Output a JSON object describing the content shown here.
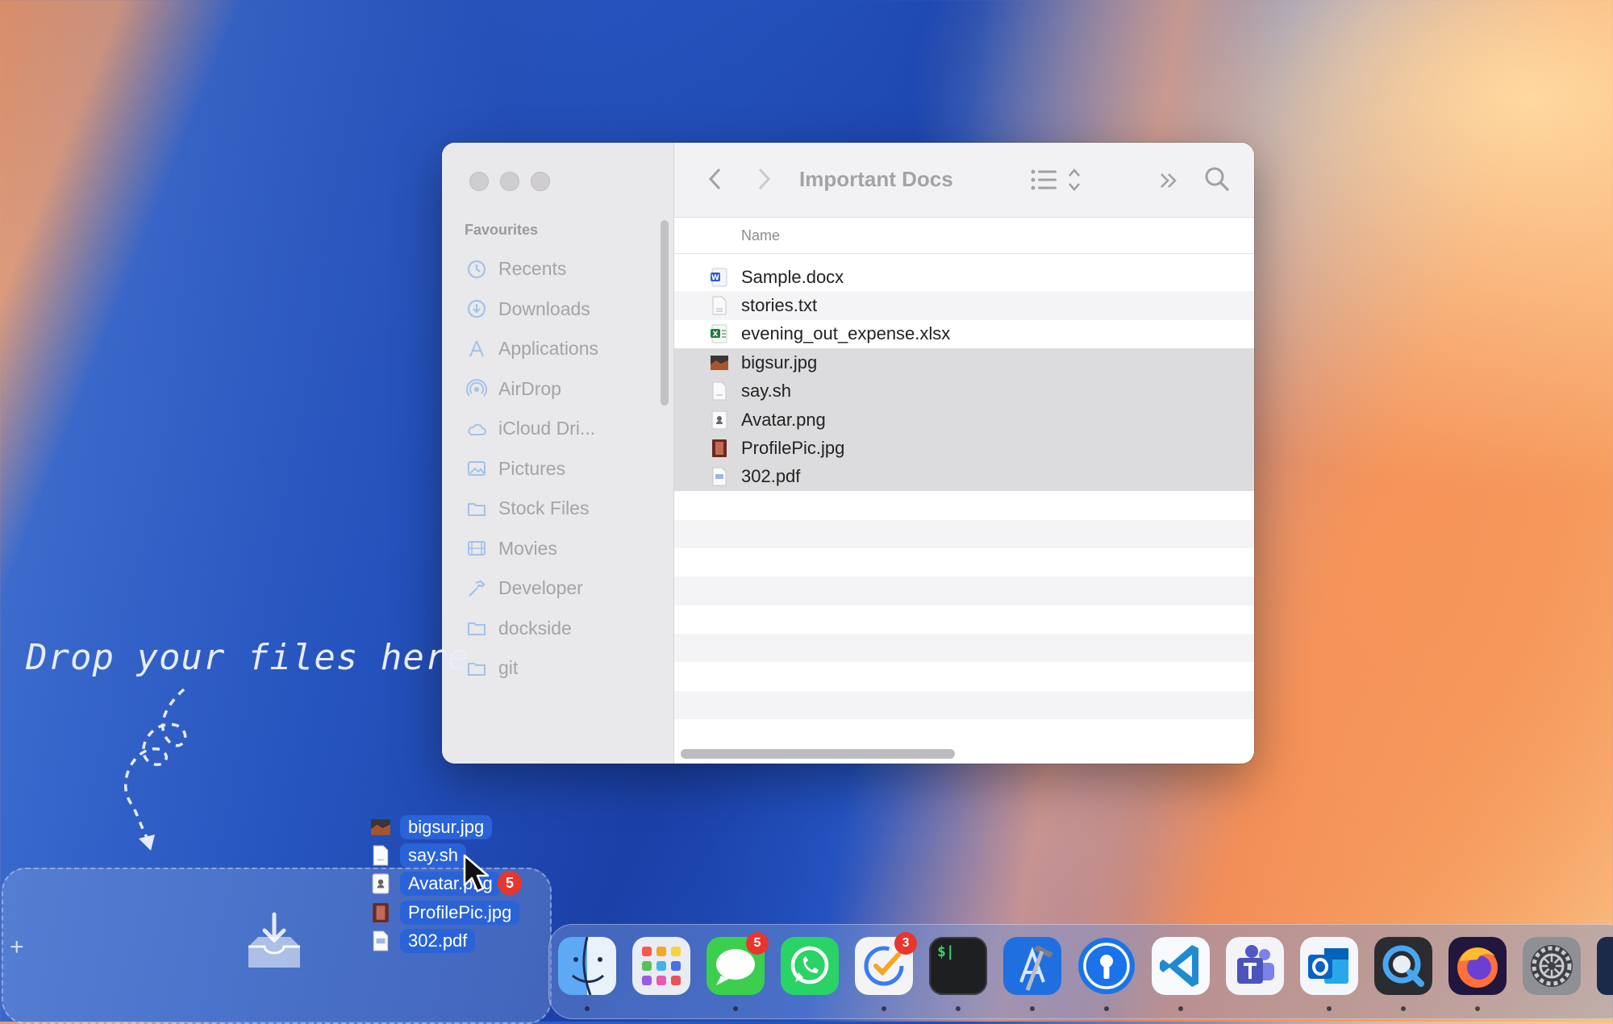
{
  "finder": {
    "title": "Important Docs",
    "sidebar_heading": "Favourites",
    "sidebar_items": [
      {
        "label": "Recents",
        "icon": "clock-icon"
      },
      {
        "label": "Downloads",
        "icon": "download-circle-icon"
      },
      {
        "label": "Applications",
        "icon": "applications-icon"
      },
      {
        "label": "AirDrop",
        "icon": "airdrop-icon"
      },
      {
        "label": "iCloud Dri...",
        "icon": "cloud-icon"
      },
      {
        "label": "Pictures",
        "icon": "pictures-icon"
      },
      {
        "label": "Stock Files",
        "icon": "folder-icon"
      },
      {
        "label": "Movies",
        "icon": "film-icon"
      },
      {
        "label": "Developer",
        "icon": "hammer-icon"
      },
      {
        "label": "dockside",
        "icon": "folder-icon"
      },
      {
        "label": "git",
        "icon": "folder-icon"
      }
    ],
    "column_name": "Name",
    "files": [
      {
        "name": "Sample.docx",
        "icon": "word-doc-icon",
        "selected": false
      },
      {
        "name": "stories.txt",
        "icon": "text-file-icon",
        "selected": false
      },
      {
        "name": "evening_out_expense.xlsx",
        "icon": "excel-file-icon",
        "selected": false
      },
      {
        "name": "bigsur.jpg",
        "icon": "image-file-icon",
        "selected": true
      },
      {
        "name": "say.sh",
        "icon": "script-file-icon",
        "selected": true
      },
      {
        "name": "Avatar.png",
        "icon": "png-file-icon",
        "selected": true
      },
      {
        "name": "ProfilePic.jpg",
        "icon": "photo-file-icon",
        "selected": true
      },
      {
        "name": "302.pdf",
        "icon": "pdf-file-icon",
        "selected": true
      }
    ]
  },
  "drop_zone": {
    "hint": "Drop your files here",
    "plus": "+"
  },
  "drag": {
    "items": [
      "bigsur.jpg",
      "say.sh",
      "Avatar.png",
      "ProfilePic.jpg",
      "302.pdf"
    ],
    "count_badge": "5"
  },
  "dock": {
    "apps": [
      {
        "name": "Finder",
        "icon": "finder-icon",
        "running": true
      },
      {
        "name": "Launchpad",
        "icon": "launchpad-icon",
        "running": false
      },
      {
        "name": "Messages",
        "icon": "messages-icon",
        "running": true,
        "badge": "5"
      },
      {
        "name": "WhatsApp",
        "icon": "whatsapp-icon",
        "running": false
      },
      {
        "name": "Tasks",
        "icon": "tasks-icon",
        "running": true,
        "badge": "3"
      },
      {
        "name": "Terminal",
        "icon": "terminal-icon",
        "running": true
      },
      {
        "name": "Xcode",
        "icon": "xcode-icon",
        "running": true
      },
      {
        "name": "Keys",
        "icon": "keyhole-icon",
        "running": true
      },
      {
        "name": "Visual Studio Code",
        "icon": "vscode-icon",
        "running": true
      },
      {
        "name": "Teams",
        "icon": "teams-icon",
        "running": false
      },
      {
        "name": "Outlook",
        "icon": "outlook-icon",
        "running": true
      },
      {
        "name": "QuickTime",
        "icon": "quicktime-icon",
        "running": true
      },
      {
        "name": "Firefox",
        "icon": "firefox-icon",
        "running": true
      },
      {
        "name": "System Settings",
        "icon": "settings-gear-icon",
        "running": false
      }
    ],
    "terminal_prompt": "$|"
  }
}
